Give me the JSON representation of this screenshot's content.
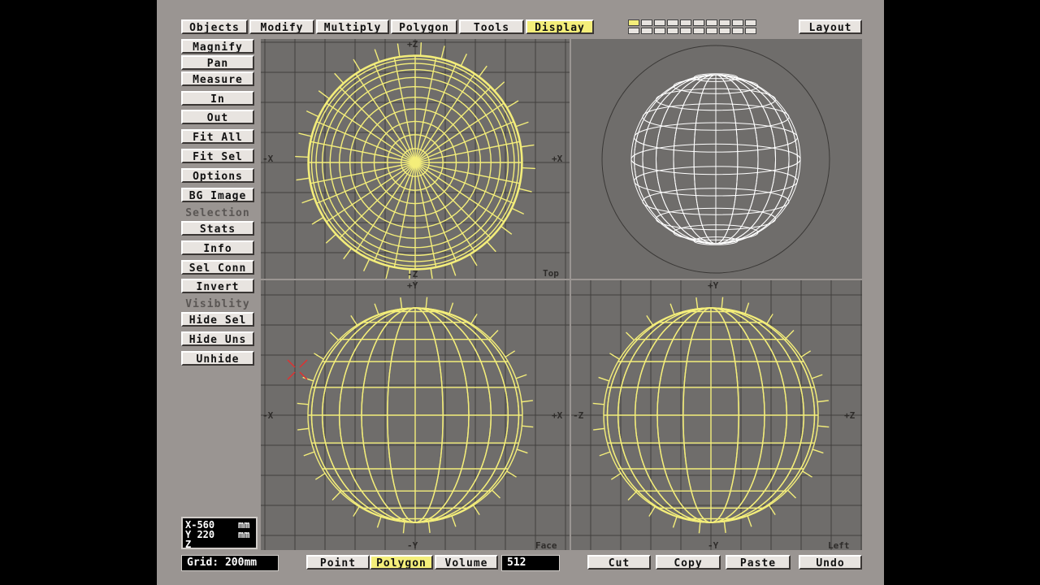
{
  "menu": [
    "Objects",
    "Modify",
    "Multiply",
    "Polygon",
    "Tools",
    "Display"
  ],
  "menu_active": "Display",
  "layout_button": "Layout",
  "tools": {
    "view": [
      "Magnify",
      "Pan",
      "Measure",
      "In",
      "Out",
      "Fit All",
      "Fit Sel",
      "Options",
      "BG Image"
    ],
    "selection_label": "Selection",
    "selection": [
      "Stats",
      "Info",
      "Sel Conn",
      "Invert"
    ],
    "visibility_label": "Visiblity",
    "visibility": [
      "Hide Sel",
      "Hide Uns",
      "Unhide"
    ]
  },
  "viewports": {
    "top": {
      "label": "Top",
      "ax_top": "+Z",
      "ax_bottom": "-Z",
      "ax_left": "-X",
      "ax_right": "+X"
    },
    "face": {
      "label": "Face",
      "ax_top": "+Y",
      "ax_bottom": "-Y",
      "ax_left": "-X",
      "ax_right": "+X"
    },
    "left": {
      "label": "Left",
      "ax_top": "+Y",
      "ax_bottom": "-Y",
      "ax_left": "-Z",
      "ax_right": "+Z"
    }
  },
  "coords": {
    "x": "X-560    mm",
    "y": "Y 220    mm",
    "z": "Z"
  },
  "grid": "Grid: 200mm",
  "mode_buttons": [
    "Point",
    "Polygon",
    "Volume"
  ],
  "mode_active": "Polygon",
  "count": "512",
  "edit_buttons": [
    "Cut",
    "Copy",
    "Paste",
    "Undo"
  ],
  "colors": {
    "wire": "#f4ee7a",
    "persp_wire": "#ffffff",
    "viewport_bg": "#6f6d6b",
    "panel": "#9a9592"
  }
}
